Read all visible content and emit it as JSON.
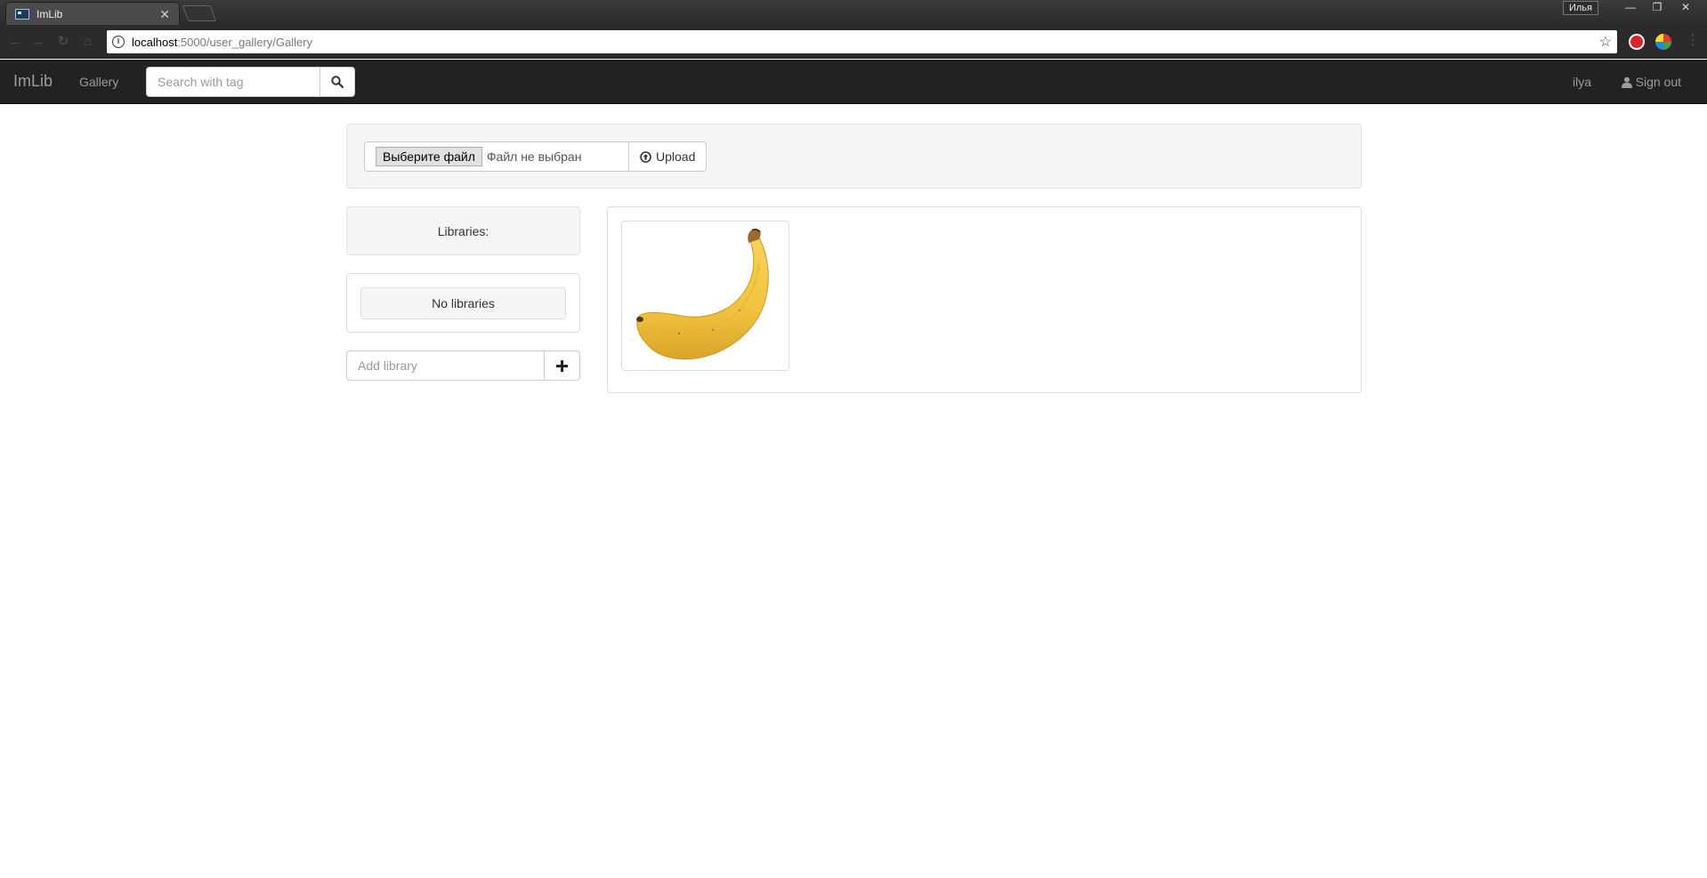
{
  "browser": {
    "tab_title": "ImLib",
    "profile_name": "Илья",
    "url_host": "localhost",
    "url_path": ":5000/user_gallery/Gallery"
  },
  "navbar": {
    "brand": "ImLib",
    "gallery_link": "Gallery",
    "search_placeholder": "Search with tag",
    "username": "ilya",
    "signout_label": "Sign out"
  },
  "upload": {
    "choose_file_label": "Выберите файл",
    "file_status": "Файл не выбран",
    "upload_label": "Upload"
  },
  "libraries": {
    "header": "Libraries:",
    "empty_message": "No libraries",
    "add_placeholder": "Add library"
  },
  "gallery": {
    "images": [
      {
        "subject": "banana"
      }
    ]
  },
  "colors": {
    "navbar_bg": "#222222",
    "navbar_text": "#9d9d9d",
    "panel_bg": "#f5f5f5",
    "banana": "#f4c542"
  }
}
